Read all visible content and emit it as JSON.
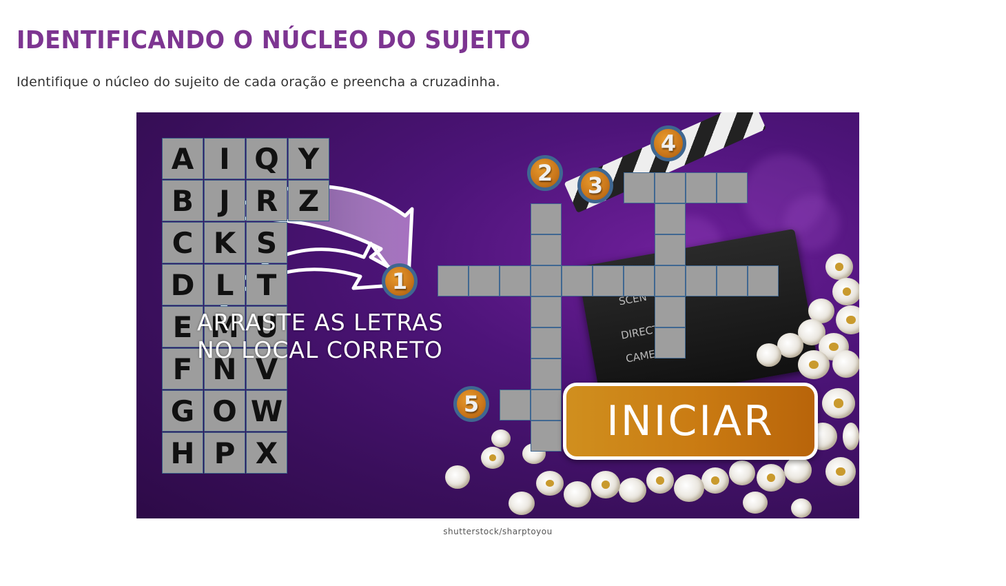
{
  "page": {
    "title": "IDENTIFICANDO O NÚCLEO DO SUJEITO",
    "instructions": "Identifique o núcleo do sujeito de cada oração e preencha a cruzadinha.",
    "credit": "shutterstock/sharptoyou"
  },
  "game": {
    "letter_bank": [
      [
        "A",
        "I",
        "Q",
        "Y"
      ],
      [
        "B",
        "J",
        "R",
        "Z"
      ],
      [
        "C",
        "K",
        "S"
      ],
      [
        "D",
        "L",
        "T"
      ],
      [
        "E",
        "M",
        "U"
      ],
      [
        "F",
        "N",
        "V"
      ],
      [
        "G",
        "O",
        "W"
      ],
      [
        "H",
        "P",
        "X"
      ]
    ],
    "drag_instruction_line1": "ARRASTE AS LETRAS",
    "drag_instruction_line2": "NO LOCAL CORRETO",
    "clue_numbers": [
      "1",
      "2",
      "3",
      "4",
      "5"
    ],
    "start_button": "INICIAR",
    "clapboard_labels": [
      "SCEN",
      "DIRECT",
      "CAME"
    ],
    "colors": {
      "title": "#7d3591",
      "background": "#3a0f5c",
      "cell": "#9e9e9e",
      "cell_border": "#3f6791",
      "button": "#c97a12"
    }
  }
}
